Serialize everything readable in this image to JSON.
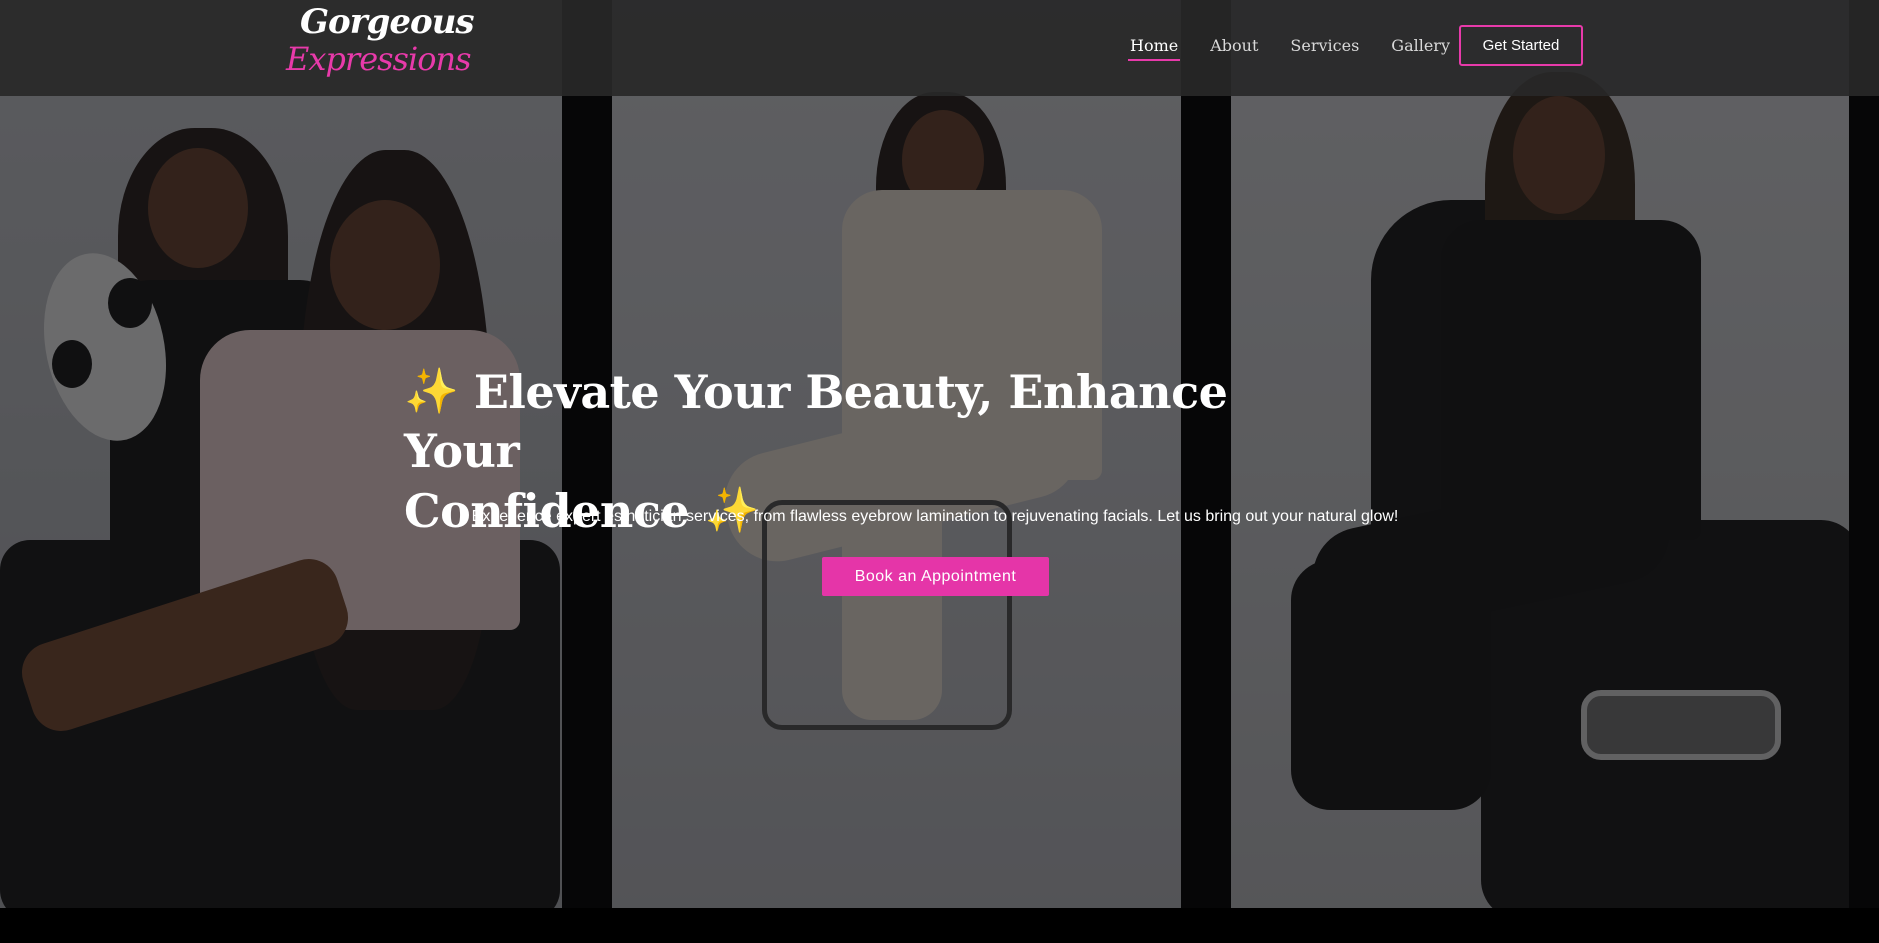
{
  "logo": {
    "line1": "Gorgeous",
    "line2": "Expressions"
  },
  "nav": {
    "items": [
      {
        "label": "Home",
        "active": true
      },
      {
        "label": "About",
        "active": false
      },
      {
        "label": "Services",
        "active": false
      },
      {
        "label": "Gallery",
        "active": false
      }
    ],
    "cta_label": "Get Started"
  },
  "hero": {
    "title_line1": "Elevate Your Beauty, Enhance Your",
    "title_line2": "Confidence",
    "sparkle": "✨",
    "subtitle": "Experience expert esthetician services, from flawless eyebrow lamination to rejuvenating facials. Let us bring out your natural glow!",
    "button_label": "Book an Appointment"
  },
  "colors": {
    "accent": "#e535a8",
    "header_bg": "#282828",
    "sparkle": "#f6c43a"
  }
}
